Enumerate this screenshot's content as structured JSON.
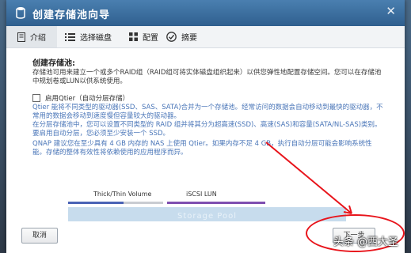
{
  "dialog": {
    "title": "创建存储池向导",
    "close_glyph": "✕"
  },
  "steps": [
    {
      "label": "介绍",
      "icon": "page-icon",
      "active": true
    },
    {
      "label": "选择磁盘",
      "icon": "list-icon"
    },
    {
      "label": "配置",
      "icon": "grid-icon"
    },
    {
      "label": "摘要",
      "icon": "check-circle-icon"
    }
  ],
  "content": {
    "section_title": "创建存储池:",
    "intro": "存储池可用来建立一个或多个RAID组（RAID组可将实体磁盘组织起来）以供您弹性地配置存储空间。您可以在存储池中规划卷或LUN以供系统使用。",
    "qtier_checkbox_label": "启用Qtier（自动分层存储）",
    "qtier_checked": false,
    "qtier_desc_1": "Qtier 能将不同类型的驱动器(SSD、SAS、SATA)合并为一个存储池。经常访问的数据会自动移动到最快的驱动器，不常用的数据会移动到速度慢但容量较大的驱动器。",
    "qtier_desc_2": "在分层存储池中，您可以设置不同类型的 RAID 组并将其分为超高速(SSD)、高速(SAS)和容量(SATA/NL-SAS)类别。要启用自动分层，您必须至少安装一个 SSD。",
    "qtier_desc_3": "QNAP 建议您在至少具有 4 GB 内存的 NAS 上使用 Qtier。如果内存不足 4 GB，执行自动分层可能会影响系统性能。存储的整体有效性将依赖使用的应用程序而异。"
  },
  "diagram": {
    "label_left": "Thick/Thin Volume",
    "label_right": "iSCSI LUN",
    "pool_label": "Storage Pool",
    "colors": {
      "volume_bar": "#4a63b5",
      "volume_bar_rest": "#c9ccd2",
      "lun_bar": "#7f4fb0",
      "pool": "#c7dced"
    }
  },
  "buttons": {
    "cancel": "取消",
    "next": "下一步"
  },
  "annotation": {
    "color": "#e8141b",
    "watermark": "头条 @西大圣"
  }
}
